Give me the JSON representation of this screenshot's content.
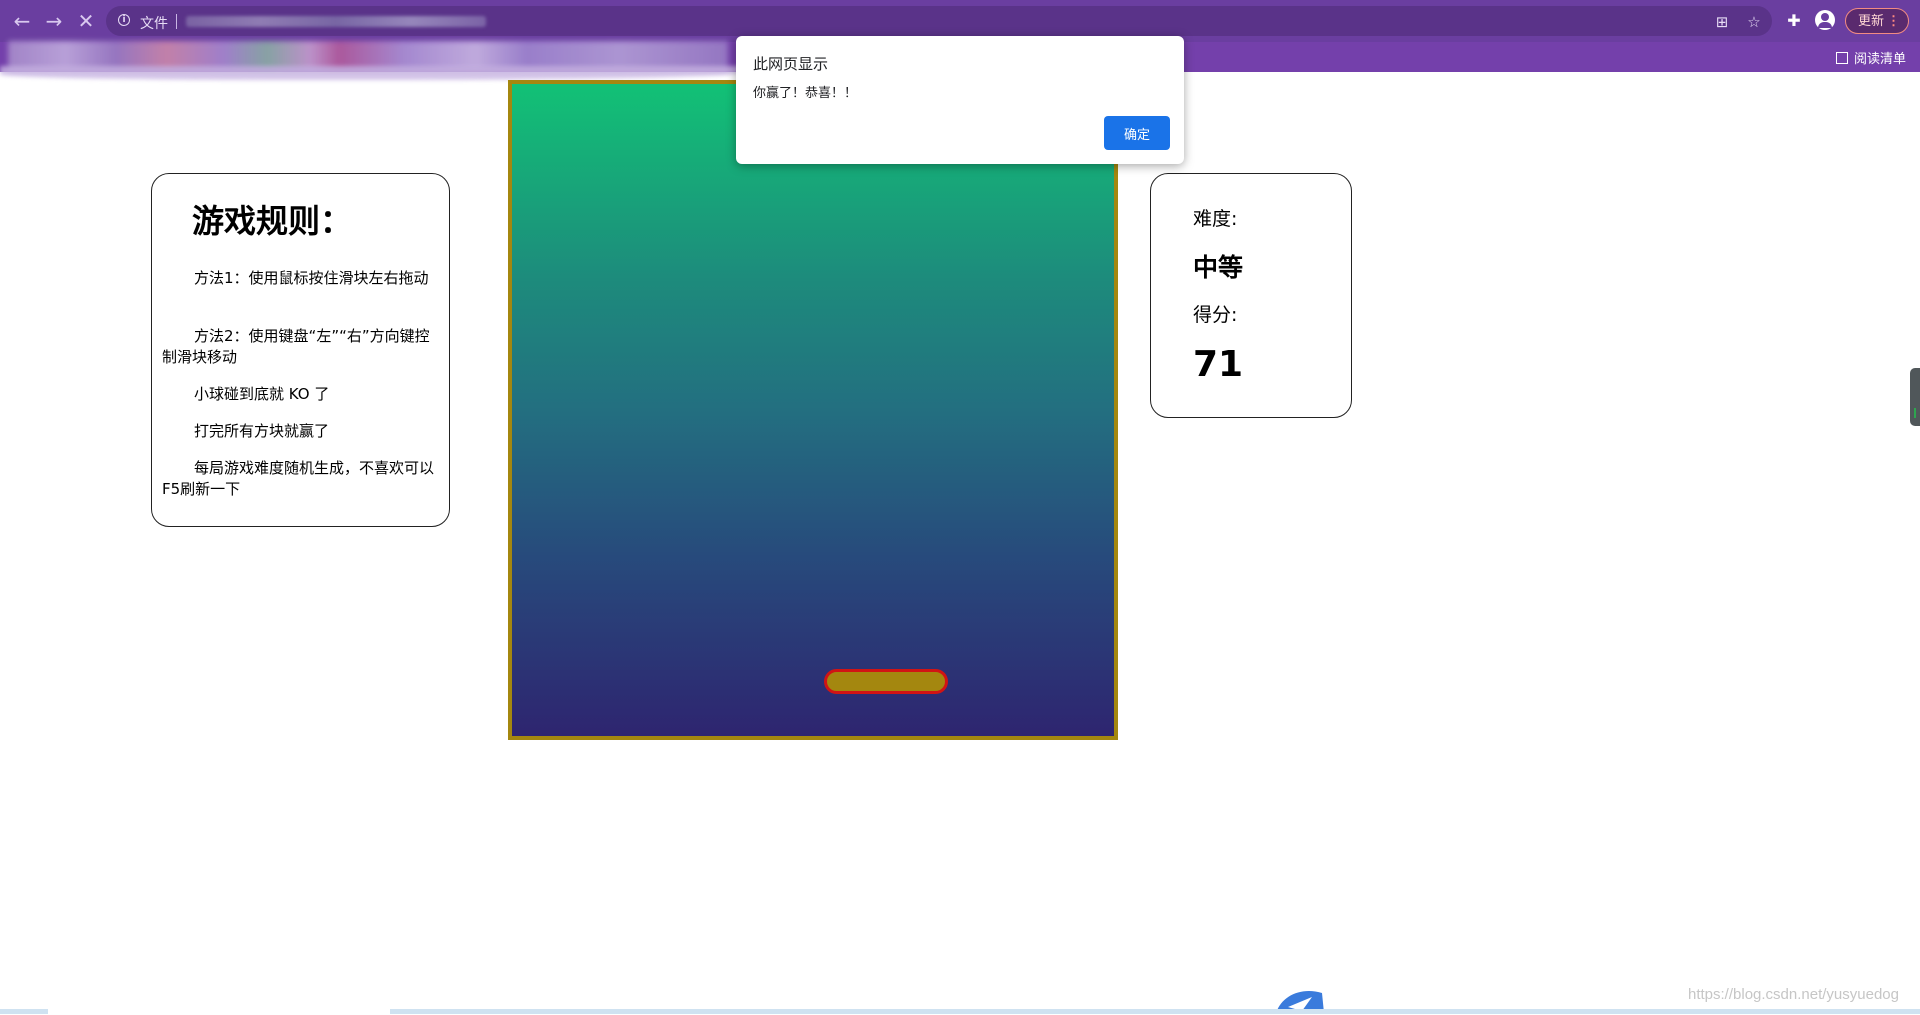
{
  "browser": {
    "address_scheme": "文件",
    "update_label": "更新",
    "reading_list_label": "阅读清单",
    "icons": [
      "back-arrow-icon",
      "forward-arrow-icon",
      "stop-loading-icon",
      "info-icon",
      "translate-icon",
      "star-icon",
      "extensions-icon",
      "profile-icon",
      "menu-dots-icon",
      "reading-list-icon"
    ]
  },
  "rules": {
    "title": "游戏规则：",
    "items": [
      "方法1：使用鼠标按住滑块左右拖动",
      "方法2：使用键盘“左”“右”方向键控制滑块移动",
      "小球碰到底就 KO 了",
      "打完所有方块就赢了",
      "每局游戏难度随机生成，不喜欢可以F5刷新一下"
    ]
  },
  "info": {
    "difficulty_label": "难度:",
    "difficulty_value": "中等",
    "score_label": "得分:",
    "score_value": "71"
  },
  "dialog": {
    "title": "此网页显示",
    "message": "你赢了！恭喜！！",
    "ok_label": "确定"
  },
  "colors": {
    "board_top": "#12c176",
    "board_bottom": "#2e2570",
    "board_border": "#a4870f",
    "paddle_fill": "#a4870f",
    "paddle_border": "#d11414",
    "dialog_button": "#1a73e8"
  },
  "watermark": "https://blog.csdn.net/yusyuedog"
}
